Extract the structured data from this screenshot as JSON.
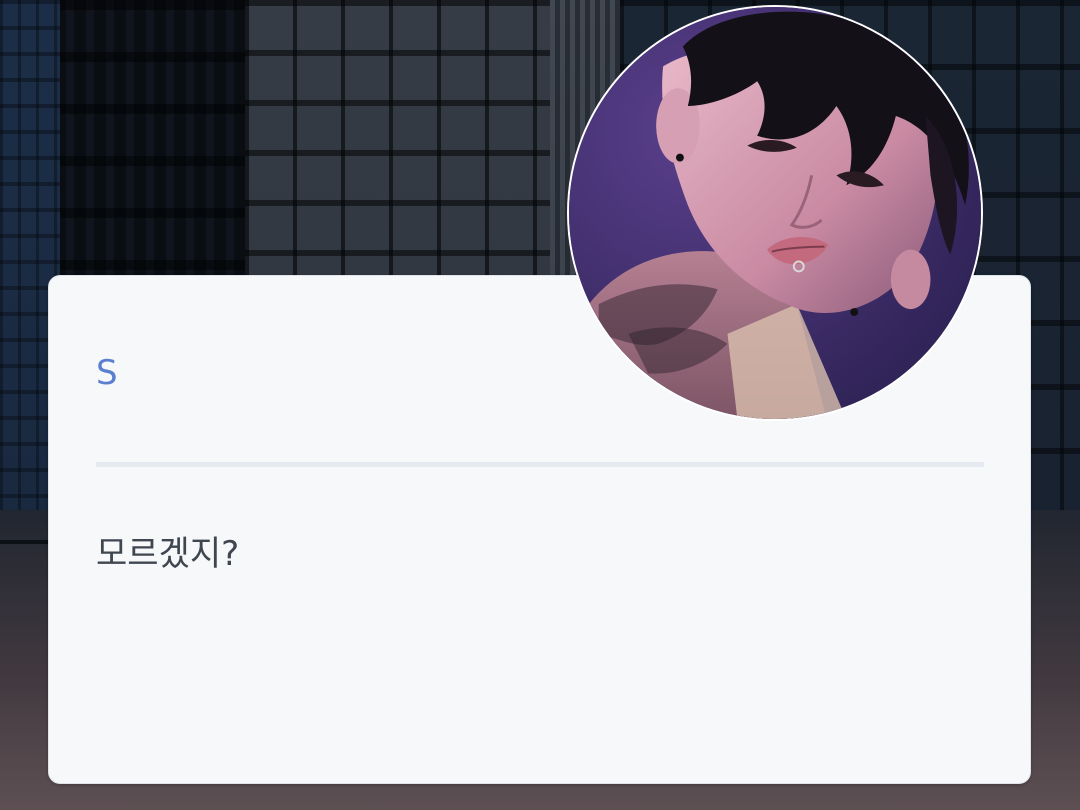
{
  "card": {
    "title": "S",
    "message": "모르겠지?"
  },
  "avatar": {
    "icon": "profile-photo"
  },
  "colors": {
    "title": "#5b7fd0",
    "message": "#3f4650",
    "card_background": "#f6f8fa",
    "divider": "#e4eaf0",
    "avatar_background": "#4b3a7a"
  }
}
